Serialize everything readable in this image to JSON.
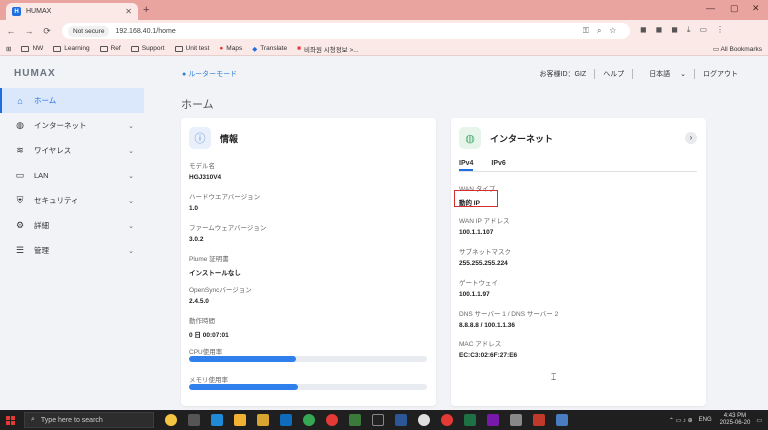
{
  "browser": {
    "tab_title": "HUMAX",
    "tab_favicon": "H",
    "not_secure": "Not secure",
    "url": "192.168.40.1/home",
    "bookmarks": [
      "NW",
      "Learning",
      "Ref",
      "Support",
      "Unit test",
      "Maps",
      "Translate",
      "비좌원 시청정보 >..."
    ],
    "all_bookmarks": "All Bookmarks"
  },
  "header": {
    "logo": "HUMAX",
    "router_mode": "ルーターモード",
    "customer_id": "お客様ID：GIZ",
    "help": "ヘルプ",
    "language": "日本語",
    "logout": "ログアウト"
  },
  "sidebar": {
    "items": [
      {
        "label": "ホーム",
        "icon": "home-icon"
      },
      {
        "label": "インターネット",
        "icon": "globe-icon"
      },
      {
        "label": "ワイヤレス",
        "icon": "wifi-icon"
      },
      {
        "label": "LAN",
        "icon": "monitor-icon"
      },
      {
        "label": "セキュリティ",
        "icon": "shield-icon"
      },
      {
        "label": "詳細",
        "icon": "gear-icon"
      },
      {
        "label": "管理",
        "icon": "sliders-icon"
      }
    ]
  },
  "main": {
    "page_title": "ホーム",
    "info_card": {
      "title": "情報",
      "fields": [
        {
          "label": "モデル名",
          "value": "HGJ310V4"
        },
        {
          "label": "ハードウエアバージョン",
          "value": "1.0"
        },
        {
          "label": "ファームウェアバージョン",
          "value": "3.0.2"
        },
        {
          "label": "Plume 証明書",
          "value": "インストールなし"
        },
        {
          "label": "OpenSyncバージョン",
          "value": "2.4.5.0"
        },
        {
          "label": "動作時間",
          "value": "0 日 00:07:01"
        }
      ],
      "cpu_label": "CPU使用率",
      "cpu_usage": 0.45,
      "mem_label": "メモリ使用率",
      "mem_usage": 0.46
    },
    "internet_card": {
      "title": "インターネット",
      "tabs": [
        "IPv4",
        "IPv6"
      ],
      "fields": [
        {
          "label": "WAN タイプ",
          "value": "動的 IP"
        },
        {
          "label": "WAN IP アドレス",
          "value": "100.1.1.107"
        },
        {
          "label": "サブネットマスク",
          "value": "255.255.255.224"
        },
        {
          "label": "ゲートウェイ",
          "value": "100.1.1.97"
        },
        {
          "label": "DNS サーバー 1 / DNS サーバー 2",
          "value": "8.8.8.8 / 100.1.1.36"
        },
        {
          "label": "MAC アドレス",
          "value": "EC:C3:02:6F:27:E6"
        }
      ]
    }
  },
  "taskbar": {
    "search_placeholder": "Type here to search",
    "lang": "ENG",
    "time": "4:43 PM",
    "date": "2025-06-20"
  },
  "colors": {
    "accent": "#1f6fe0",
    "highlight_box": "#d32f2f",
    "tabbar": "#e9a4a0"
  }
}
